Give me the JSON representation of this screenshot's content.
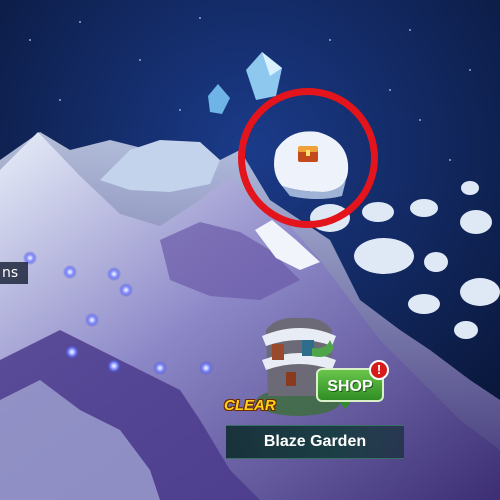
{
  "map": {
    "region_label_partial": "ns",
    "stage": {
      "clear_label": "CLEAR",
      "name": "Blaze Garden"
    },
    "shop": {
      "label": "SHOP",
      "alert": "!"
    }
  },
  "colors": {
    "sky": "#0b1a44",
    "marker_ring": "#e3141b",
    "shop_green": "#2f8d25",
    "clear_gold": "#ffd21a"
  },
  "icons": [
    "treasure-chest-icon",
    "alert-icon",
    "path-node-icon"
  ]
}
